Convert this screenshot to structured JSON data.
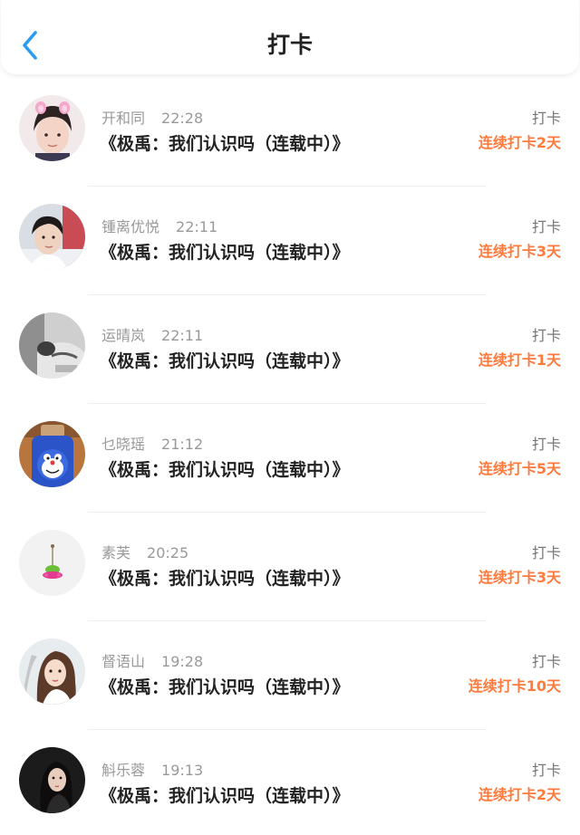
{
  "header": {
    "title": "打卡",
    "back_icon": "chevron-left-icon",
    "accent_color": "#2b9cf2"
  },
  "streak_color": "#ff7a3d",
  "records": [
    {
      "name": "开和同",
      "time": "22:28",
      "content": "《极禹：我们认识吗（连载中）》",
      "action": "打卡",
      "streak": "连续打卡2天",
      "avatar": "avatar-girl-bunny-ears-icon"
    },
    {
      "name": "锺离优悦",
      "time": "22:11",
      "content": "《极禹：我们认识吗（连载中）》",
      "action": "打卡",
      "streak": "连续打卡3天",
      "avatar": "avatar-boy-icon"
    },
    {
      "name": "运晴岚",
      "time": "22:11",
      "content": "《极禹：我们认识吗（连载中）》",
      "action": "打卡",
      "streak": "连续打卡1天",
      "avatar": "avatar-grayscale-photo-icon"
    },
    {
      "name": "乜晓瑶",
      "time": "21:12",
      "content": "《极禹：我们认识吗（连载中）》",
      "action": "打卡",
      "streak": "连续打卡5天",
      "avatar": "avatar-doraemon-jar-icon"
    },
    {
      "name": "素芙",
      "time": "20:25",
      "content": "《极禹：我们认识吗（连载中）》",
      "action": "打卡",
      "streak": "连续打卡3天",
      "avatar": "avatar-small-plant-icon"
    },
    {
      "name": "督语山",
      "time": "19:28",
      "content": "《极禹：我们认识吗（连载中）》",
      "action": "打卡",
      "streak": "连续打卡10天",
      "avatar": "avatar-woman-portrait-icon"
    },
    {
      "name": "斛乐蓉",
      "time": "19:13",
      "content": "《极禹：我们认识吗（连载中）》",
      "action": "打卡",
      "streak": "连续打卡2天",
      "avatar": "avatar-dark-portrait-icon"
    }
  ]
}
